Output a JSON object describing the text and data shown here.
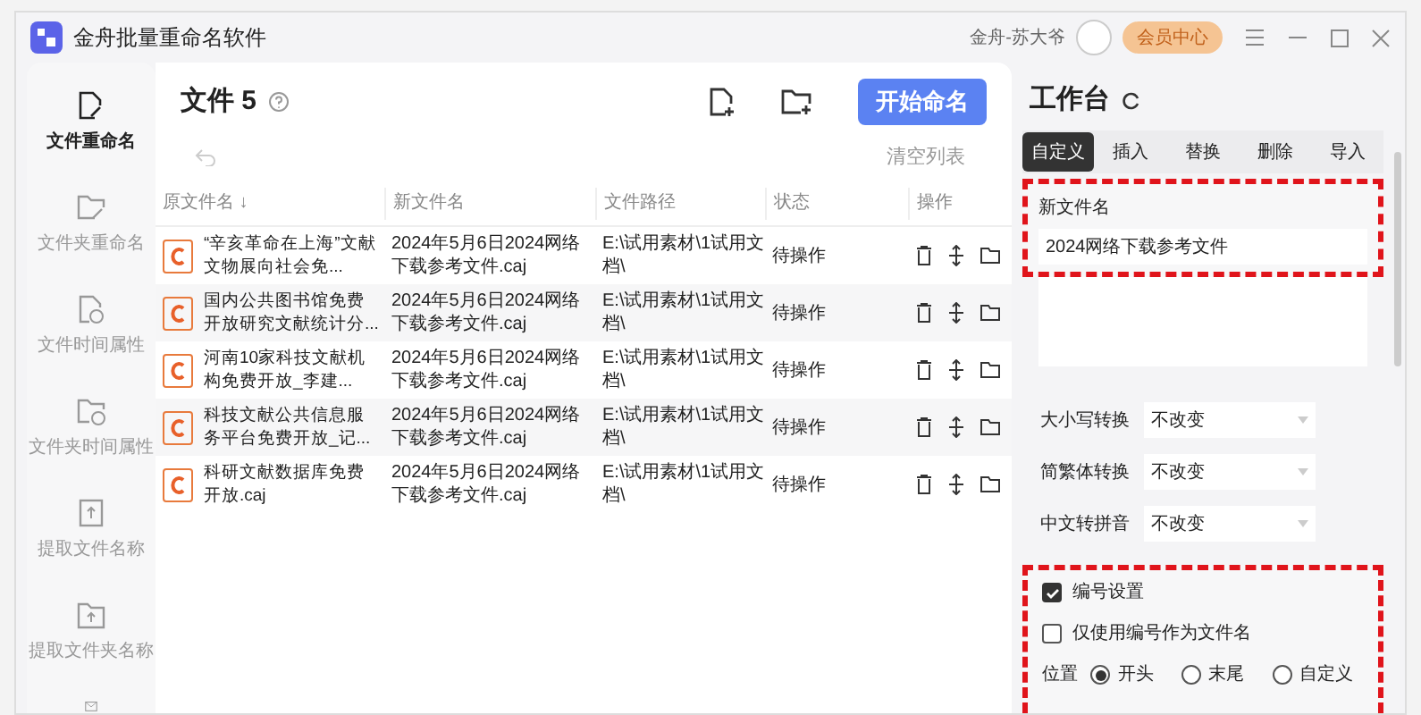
{
  "window": {
    "title": "金舟批量重命名软件",
    "user": "金舟-苏大爷",
    "vip_button": "会员中心"
  },
  "sidebar": {
    "items": [
      {
        "label": "文件重命名",
        "selected": true
      },
      {
        "label": "文件夹重命名",
        "selected": false
      },
      {
        "label": "文件时间属性",
        "selected": false
      },
      {
        "label": "文件夹时间属性",
        "selected": false
      },
      {
        "label": "提取文件名称",
        "selected": false
      },
      {
        "label": "提取文件夹名称",
        "selected": false
      }
    ]
  },
  "files": {
    "title": "文件",
    "count": "5",
    "start_button": "开始命名",
    "clear_link": "清空列表",
    "columns": [
      "原文件名 ↓",
      "新文件名",
      "文件路径",
      "状态",
      "操作"
    ],
    "rows": [
      {
        "original": "“辛亥革命在上海”文献文物展向社会免...",
        "new": "2024年5月6日2024网络下载参考文件.caj",
        "path": "E:\\试用素材\\1试用文档\\",
        "status": "待操作"
      },
      {
        "original": "国内公共图书馆免费开放研究文献统计分...",
        "new": "2024年5月6日2024网络下载参考文件.caj",
        "path": "E:\\试用素材\\1试用文档\\",
        "status": "待操作"
      },
      {
        "original": "河南10家科技文献机构免费开放_李建...",
        "new": "2024年5月6日2024网络下载参考文件.caj",
        "path": "E:\\试用素材\\1试用文档\\",
        "status": "待操作"
      },
      {
        "original": "科技文献公共信息服务平台免费开放_记...",
        "new": "2024年5月6日2024网络下载参考文件.caj",
        "path": "E:\\试用素材\\1试用文档\\",
        "status": "待操作"
      },
      {
        "original": "科研文献数据库免费开放.caj",
        "new": "2024年5月6日2024网络下载参考文件.caj",
        "path": "E:\\试用素材\\1试用文档\\",
        "status": "待操作"
      }
    ]
  },
  "workbench": {
    "title": "工作台",
    "tabs": [
      {
        "label": "自定义",
        "selected": true
      },
      {
        "label": "插入",
        "selected": false
      },
      {
        "label": "替换",
        "selected": false
      },
      {
        "label": "删除",
        "selected": false
      },
      {
        "label": "导入",
        "selected": false
      }
    ],
    "new_name_label": "新文件名",
    "new_name_value": "2024网络下载参考文件",
    "options": [
      {
        "label": "大小写转换",
        "value": "不改变"
      },
      {
        "label": "简繁体转换",
        "value": "不改变"
      },
      {
        "label": "中文转拼音",
        "value": "不改变"
      }
    ],
    "checkboxes": [
      {
        "label": "编号设置",
        "checked": true
      },
      {
        "label": "仅使用编号作为文件名",
        "checked": false
      }
    ],
    "position": {
      "label": "位置",
      "choices": [
        {
          "label": "开头",
          "selected": true
        },
        {
          "label": "末尾",
          "selected": false
        },
        {
          "label": "自定义",
          "selected": false
        }
      ]
    }
  }
}
